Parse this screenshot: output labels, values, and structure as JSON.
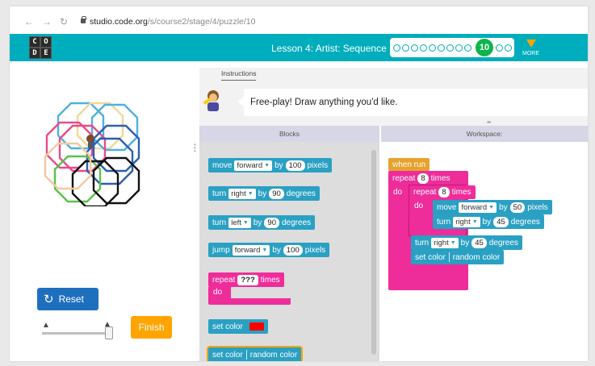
{
  "browser": {
    "url_domain": "studio.code.org",
    "url_path": "/s/course2/stage/4/puzzle/10",
    "icons": [
      "back-arrow-icon",
      "forward-arrow-icon",
      "reload-icon",
      "lock-icon"
    ]
  },
  "header": {
    "logo": [
      "C",
      "O",
      "D",
      "E"
    ],
    "lesson_title": "Lesson 4: Artist: Sequence",
    "current_level": "10",
    "more_label": "MORE"
  },
  "instructions": {
    "tab_label": "Instructions",
    "text": "Free-play! Draw anything you'd like."
  },
  "controls": {
    "reset_label": "Reset",
    "finish_label": "Finish"
  },
  "panels": {
    "blocks_header": "Blocks",
    "workspace_header": "Workspace:"
  },
  "toolbox": {
    "move": {
      "verb": "move",
      "dir": "forward",
      "by": "by",
      "value": "100",
      "unit": "pixels"
    },
    "turn_right": {
      "verb": "turn",
      "dir": "right",
      "by": "by",
      "value": "90",
      "unit": "degrees"
    },
    "turn_left": {
      "verb": "turn",
      "dir": "left",
      "by": "by",
      "value": "90",
      "unit": "degrees"
    },
    "jump": {
      "verb": "jump",
      "dir": "forward",
      "by": "by",
      "value": "100",
      "unit": "pixels"
    },
    "repeat": {
      "verb": "repeat",
      "value": "???",
      "times": "times",
      "do": "do"
    },
    "set_color": {
      "label": "set color",
      "color": "#ff0000"
    },
    "set_random": {
      "label": "set color",
      "value": "random color"
    }
  },
  "workspace": {
    "when_run": "when run",
    "outer_repeat": {
      "verb": "repeat",
      "value": "8",
      "times": "times",
      "do": "do"
    },
    "inner_repeat": {
      "verb": "repeat",
      "value": "8",
      "times": "times",
      "do": "do"
    },
    "inner_move": {
      "verb": "move",
      "dir": "forward",
      "by": "by",
      "value": "50",
      "unit": "pixels"
    },
    "inner_turn": {
      "verb": "turn",
      "dir": "right",
      "by": "by",
      "value": "45",
      "unit": "degrees"
    },
    "outer_turn": {
      "verb": "turn",
      "dir": "right",
      "by": "by",
      "value": "45",
      "unit": "degrees"
    },
    "set_color": {
      "label": "set color",
      "value": "random color"
    }
  }
}
